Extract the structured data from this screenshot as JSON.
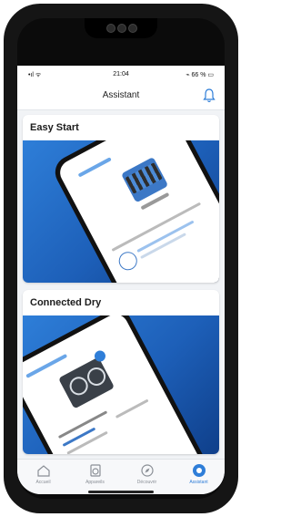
{
  "status_bar": {
    "carrier": "•ıl ᯤ",
    "time": "21:04",
    "right": "⌁ 66 % ▭"
  },
  "header": {
    "title": "Assistant"
  },
  "cards": [
    {
      "title": "Easy Start"
    },
    {
      "title": "Connected Dry"
    }
  ],
  "tabs": [
    {
      "label": "Accueil"
    },
    {
      "label": "Appareils"
    },
    {
      "label": "Découvrir"
    },
    {
      "label": "Assistant"
    }
  ],
  "colors": {
    "accent": "#2f7ed8",
    "card_image": "#1d5fb8"
  }
}
